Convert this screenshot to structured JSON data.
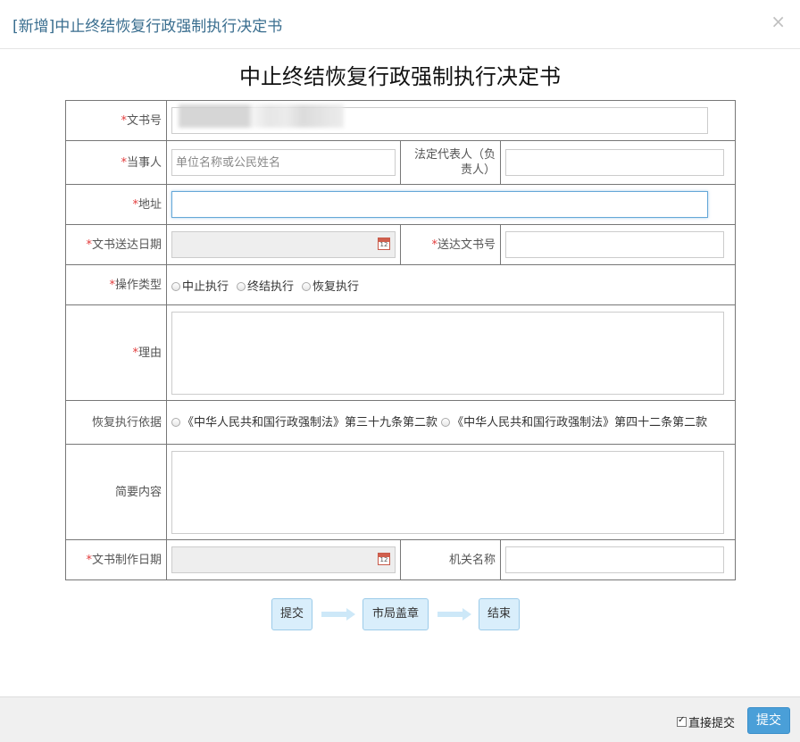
{
  "modal": {
    "title": "[新增]中止终结恢复行政强制执行决定书",
    "close_symbol": "×"
  },
  "document": {
    "title": "中止终结恢复行政强制执行决定书"
  },
  "form": {
    "required_mark": "*",
    "doc_number": {
      "label": "文书号",
      "value": ""
    },
    "party": {
      "label": "当事人",
      "placeholder": "单位名称或公民姓名",
      "value": ""
    },
    "legal_rep": {
      "label": "法定代表人（负责人）",
      "value": ""
    },
    "address": {
      "label": "地址",
      "value": ""
    },
    "delivery_date": {
      "label": "文书送达日期",
      "value": ""
    },
    "delivery_doc_number": {
      "label": "送达文书号",
      "value": ""
    },
    "operation_type": {
      "label": "操作类型",
      "options": [
        "中止执行",
        "终结执行",
        "恢复执行"
      ]
    },
    "reason": {
      "label": "理由",
      "value": ""
    },
    "resume_basis": {
      "label": "恢复执行依据",
      "options": [
        "《中华人民共和国行政强制法》第三十九条第二款",
        "《中华人民共和国行政强制法》第四十二条第二款"
      ]
    },
    "summary": {
      "label": "简要内容",
      "value": ""
    },
    "creation_date": {
      "label": "文书制作日期",
      "value": ""
    },
    "agency_name": {
      "label": "机关名称",
      "value": ""
    }
  },
  "workflow": {
    "steps": [
      "提交",
      "市局盖章",
      "结束"
    ]
  },
  "footer": {
    "direct_submit_label": "直接提交",
    "direct_submit_checked": true,
    "submit_label": "提交"
  },
  "icons": {
    "close": "close-icon",
    "calendar": "calendar-icon",
    "arrow": "arrow-right-icon"
  },
  "colors": {
    "title": "#3a6e8f",
    "required": "#e23c3c",
    "primary_button": "#4a9fd8",
    "step_fill": "#d9eefb"
  }
}
